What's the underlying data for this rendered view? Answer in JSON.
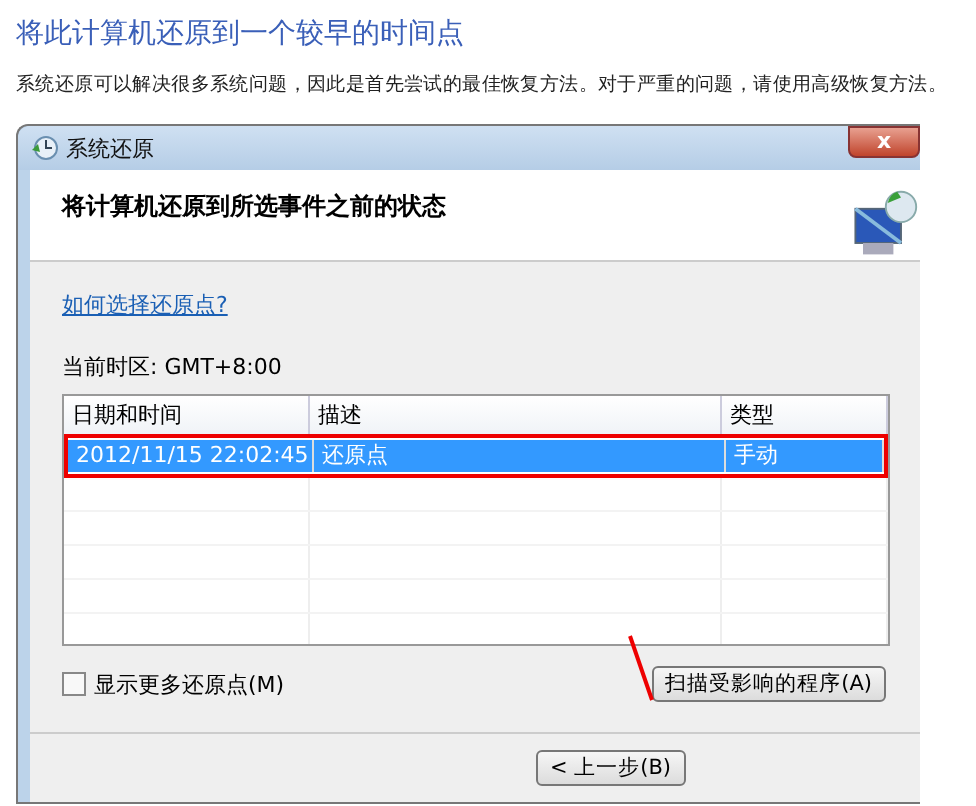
{
  "page": {
    "heading": "将此计算机还原到一个较早的时间点",
    "description": "系统还原可以解决很多系统问题，因此是首先尝试的最佳恢复方法。对于严重的问题，请使用高级恢复方法。"
  },
  "window": {
    "title": "系统还原",
    "close": "x"
  },
  "header": {
    "title": "将计算机还原到所选事件之前的状态"
  },
  "help_link": "如何选择还原点?",
  "timezone": "当前时区: GMT+8:00",
  "table": {
    "columns": [
      "日期和时间",
      "描述",
      "类型"
    ],
    "rows": [
      {
        "cells": [
          "2012/11/15 22:02:45",
          "还原点",
          "手动"
        ],
        "selected": true,
        "highlighted": true
      }
    ]
  },
  "show_more": {
    "label": "显示更多还原点(M)",
    "checked": false
  },
  "scan_button": "扫描受影响的程序(A)",
  "back_button": "< 上一步(B)"
}
